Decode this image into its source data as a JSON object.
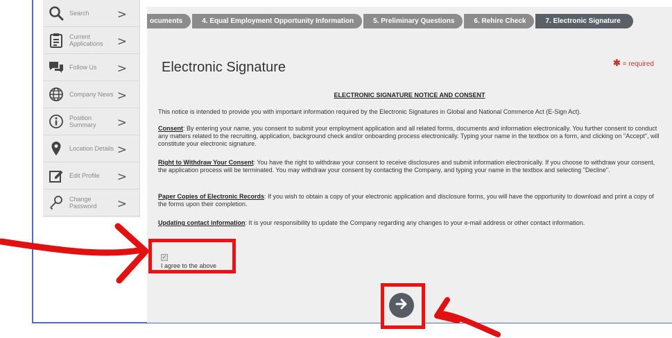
{
  "sidebar": {
    "items": [
      {
        "label": "Search",
        "icon": "search-icon"
      },
      {
        "label": "Current Applications",
        "icon": "clipboard-icon"
      },
      {
        "label": "Follow Us",
        "icon": "chat-bubbles-icon"
      },
      {
        "label": "Company News",
        "icon": "globe-icon"
      },
      {
        "label": "Position Summary",
        "icon": "info-icon"
      },
      {
        "label": "Location Details",
        "icon": "map-pin-icon"
      },
      {
        "label": "Edit Profile",
        "icon": "edit-icon"
      },
      {
        "label": "Change Password",
        "icon": "key-icon"
      }
    ]
  },
  "steps": [
    {
      "label": "ocuments"
    },
    {
      "label": "4. Equal Employment Opportunity Information"
    },
    {
      "label": "5. Preliminary Questions"
    },
    {
      "label": "6. Rehire Check"
    },
    {
      "label": "7. Electronic Signature",
      "active": true
    }
  ],
  "page": {
    "title": "Electronic Signature",
    "required_star": "✱",
    "required_label": " = required"
  },
  "notice": {
    "heading": "ELECTRONIC SIGNATURE NOTICE AND CONSENT",
    "intro": "This notice is intended to provide you with important information required by the Electronic Signatures in Global and National Commerce Act (E-Sign Act).",
    "consent_title": "Consent",
    "consent_body": ": By entering your name, you consent to submit your employment application and all related forms, documents and information electronically. You further consent to conduct any matters related to the recruiting, application, background check and/or onboarding process electronically. Typing your name in the textbox on a form, and clicking on \"Accept\", will constitute your electronic signature.",
    "withdraw_title": "Right to Withdraw Your Consent",
    "withdraw_body": ": You have the right to withdraw your consent to receive disclosures and submit information electronically. If you choose to withdraw your consent, the application process will be terminated. You may withdraw your consent by contacting the Company, and typing your name in the textbox and selecting \"Decline\".",
    "paper_title": "Paper Copies of Electronic Records",
    "paper_body": ": If you wish to obtain a copy of your electronic application and disclosure forms, you will have the opportunity to download and print a copy of the forms upon their completion.",
    "update_title": "Updating contact information",
    "update_body": ": It is your responsibility to update the Company regarding any changes to your e-mail address or other contact information."
  },
  "agree": {
    "label": "I agree to the above",
    "checked": true
  },
  "colors": {
    "annotation_red": "#e11111",
    "step_active": "#5a6068",
    "step_inactive": "#8c8c8c",
    "required": "#c0392b"
  }
}
